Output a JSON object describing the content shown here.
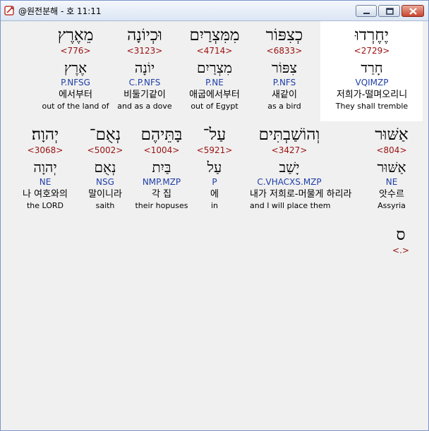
{
  "window": {
    "title": "@원전분해 - 호 11:11"
  },
  "words": [
    {
      "heb": "יֶחֶרְדוּ",
      "num": "<2729>",
      "heb2": "חָרַד",
      "pars": "VQIMZP",
      "kor": "저희가-떨며오리니",
      "eng": "They shall tremble"
    },
    {
      "heb": "כְצִפּוֹר",
      "num": "<6833>",
      "heb2": "צִפּוֹר",
      "pars": "P.NFS",
      "kor": "새같이",
      "eng": "as a bird"
    },
    {
      "heb": "מִמִּצְרַיִם",
      "num": "<4714>",
      "heb2": "מִצְרַיִם",
      "pars": "P.NE",
      "kor": "애굽에서부터",
      "eng": "out of Egypt"
    },
    {
      "heb": "וּכְיוֹנָה",
      "num": "<3123>",
      "heb2": "יוֹנָה",
      "pars": "C.P.NFS",
      "kor": "비둘기같이",
      "eng": "and as a dove"
    },
    {
      "heb": "מֵאֶרֶץ",
      "num": "<776>",
      "heb2": "אֶרֶץ",
      "pars": "P.NFSG",
      "kor": "에서부터",
      "eng": "out of the land of"
    },
    {
      "heb": "אַשּׁוּר",
      "num": "<804>",
      "heb2": "אַשּׁוּר",
      "pars": "NE",
      "kor": "앗수르",
      "eng": "Assyria"
    },
    {
      "heb": "וְהוֹשַׁבְתִּים",
      "num": "<3427>",
      "heb2": "יָשַׁב",
      "pars": "C.VHACXS.MZP",
      "kor": "내가 저희로-머물게 하리라",
      "eng": "and I will place them"
    },
    {
      "heb": "עַל־",
      "num": "<5921>",
      "heb2": "עַל",
      "pars": "P",
      "kor": "에",
      "eng": "in"
    },
    {
      "heb": "בָּתֵּיהֶם",
      "num": "<1004>",
      "heb2": "בַּיִת",
      "pars": "NMP.MZP",
      "kor": "각 집",
      "eng": "their hopuses"
    },
    {
      "heb": "נְאֻם־",
      "num": "<5002>",
      "heb2": "נְאֻם",
      "pars": "NSG",
      "kor": "말이니라",
      "eng": "saith"
    },
    {
      "heb": "יְהוָה׃",
      "num": "<3068>",
      "heb2": "יְהוָה",
      "pars": "NE",
      "kor": "나 여호와의",
      "eng": "the LORD"
    },
    {
      "heb": "ס",
      "num": "<.>"
    }
  ],
  "colors": {
    "strong_number": "#9a1010",
    "parsing": "#1e3ea8",
    "highlight": "#ffffff"
  },
  "icons": {
    "app": "bible-app-icon",
    "minimize": "minimize-icon",
    "maximize": "maximize-icon",
    "close": "close-icon"
  }
}
